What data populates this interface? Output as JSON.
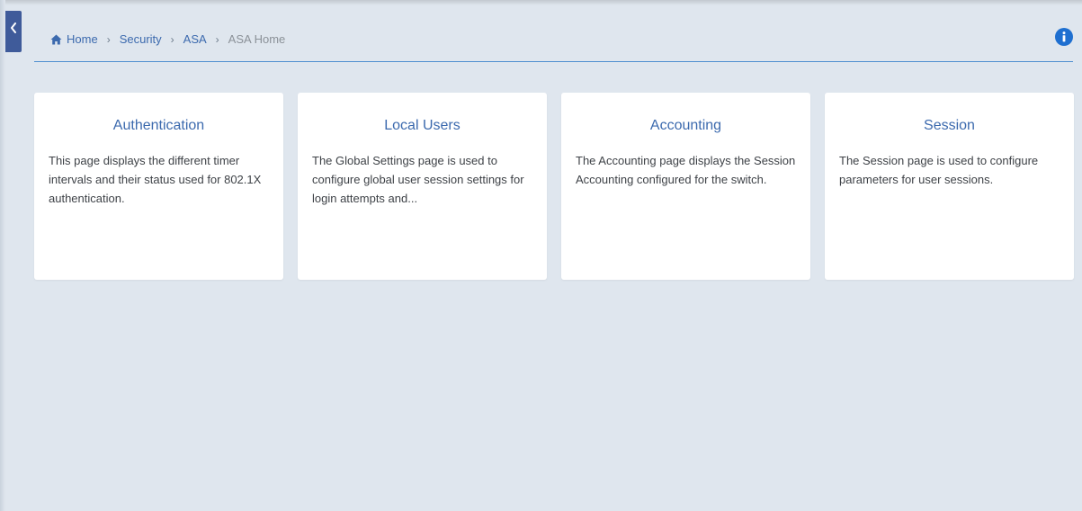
{
  "breadcrumb": {
    "items": [
      {
        "label": "Home",
        "icon": "home-icon"
      },
      {
        "label": "Security"
      },
      {
        "label": "ASA"
      }
    ],
    "current": "ASA Home",
    "separator": "›"
  },
  "header": {
    "info_icon": "info-icon"
  },
  "sidebar_toggle": {
    "icon": "chevron-left-icon"
  },
  "cards": [
    {
      "title": "Authentication",
      "description": "This page displays the different timer intervals and their status used for 802.1X authentication."
    },
    {
      "title": "Local Users",
      "description": "The Global Settings page is used to configure global user session settings for login attempts and..."
    },
    {
      "title": "Accounting",
      "description": "The Accounting page displays the Session Accounting configured for the switch."
    },
    {
      "title": "Session",
      "description": "The Session page is used to configure parameters for user sessions."
    }
  ],
  "colors": {
    "background": "#dfe6ee",
    "accent": "#3c6aae",
    "sidebar_tab": "#3f5b9a",
    "info": "#1e6fd0"
  }
}
